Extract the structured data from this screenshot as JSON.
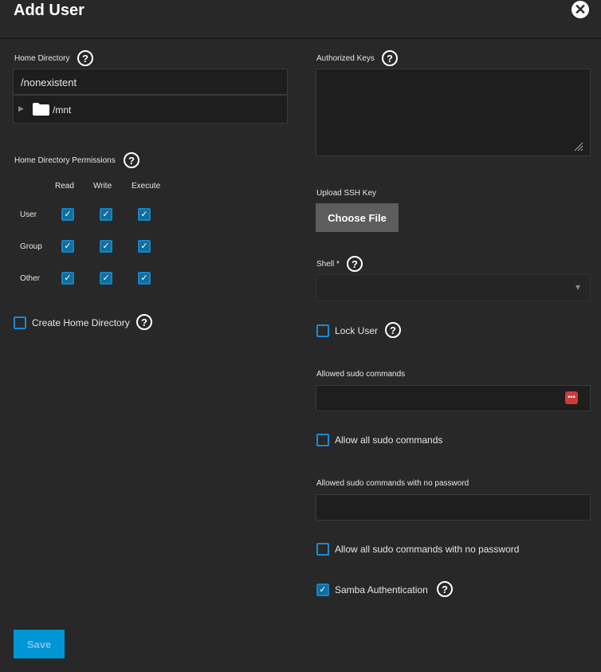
{
  "dialog": {
    "title": "Add User",
    "close_icon": "close-icon"
  },
  "home_directory": {
    "label": "Home Directory",
    "value": "/nonexistent",
    "tree_item": "/mnt"
  },
  "permissions": {
    "label": "Home Directory Permissions",
    "columns": [
      "Read",
      "Write",
      "Execute"
    ],
    "rows": [
      {
        "label": "User",
        "values": [
          true,
          true,
          true
        ]
      },
      {
        "label": "Group",
        "values": [
          true,
          true,
          true
        ]
      },
      {
        "label": "Other",
        "values": [
          true,
          true,
          true
        ]
      }
    ]
  },
  "create_home_directory": {
    "label": "Create Home Directory",
    "checked": false
  },
  "authorized_keys": {
    "label": "Authorized Keys",
    "value": ""
  },
  "upload_ssh_key": {
    "label": "Upload SSH Key",
    "button": "Choose File"
  },
  "shell": {
    "label": "Shell",
    "required_mark": "*",
    "value": ""
  },
  "lock_user": {
    "label": "Lock User",
    "checked": false
  },
  "sudo_commands": {
    "label": "Allowed sudo commands",
    "value": ""
  },
  "allow_all_sudo": {
    "label": "Allow all sudo commands",
    "checked": false
  },
  "sudo_nopasswd": {
    "label": "Allowed sudo commands with no password",
    "value": ""
  },
  "allow_all_sudo_nopasswd": {
    "label": "Allow all sudo commands with no password",
    "checked": false
  },
  "samba_auth": {
    "label": "Samba Authentication",
    "checked": true
  },
  "actions": {
    "save": "Save"
  },
  "colors": {
    "background": "#282828",
    "accent": "#0095d5",
    "checkbox": "#1a8ad2",
    "field": "#1e1e1e"
  }
}
